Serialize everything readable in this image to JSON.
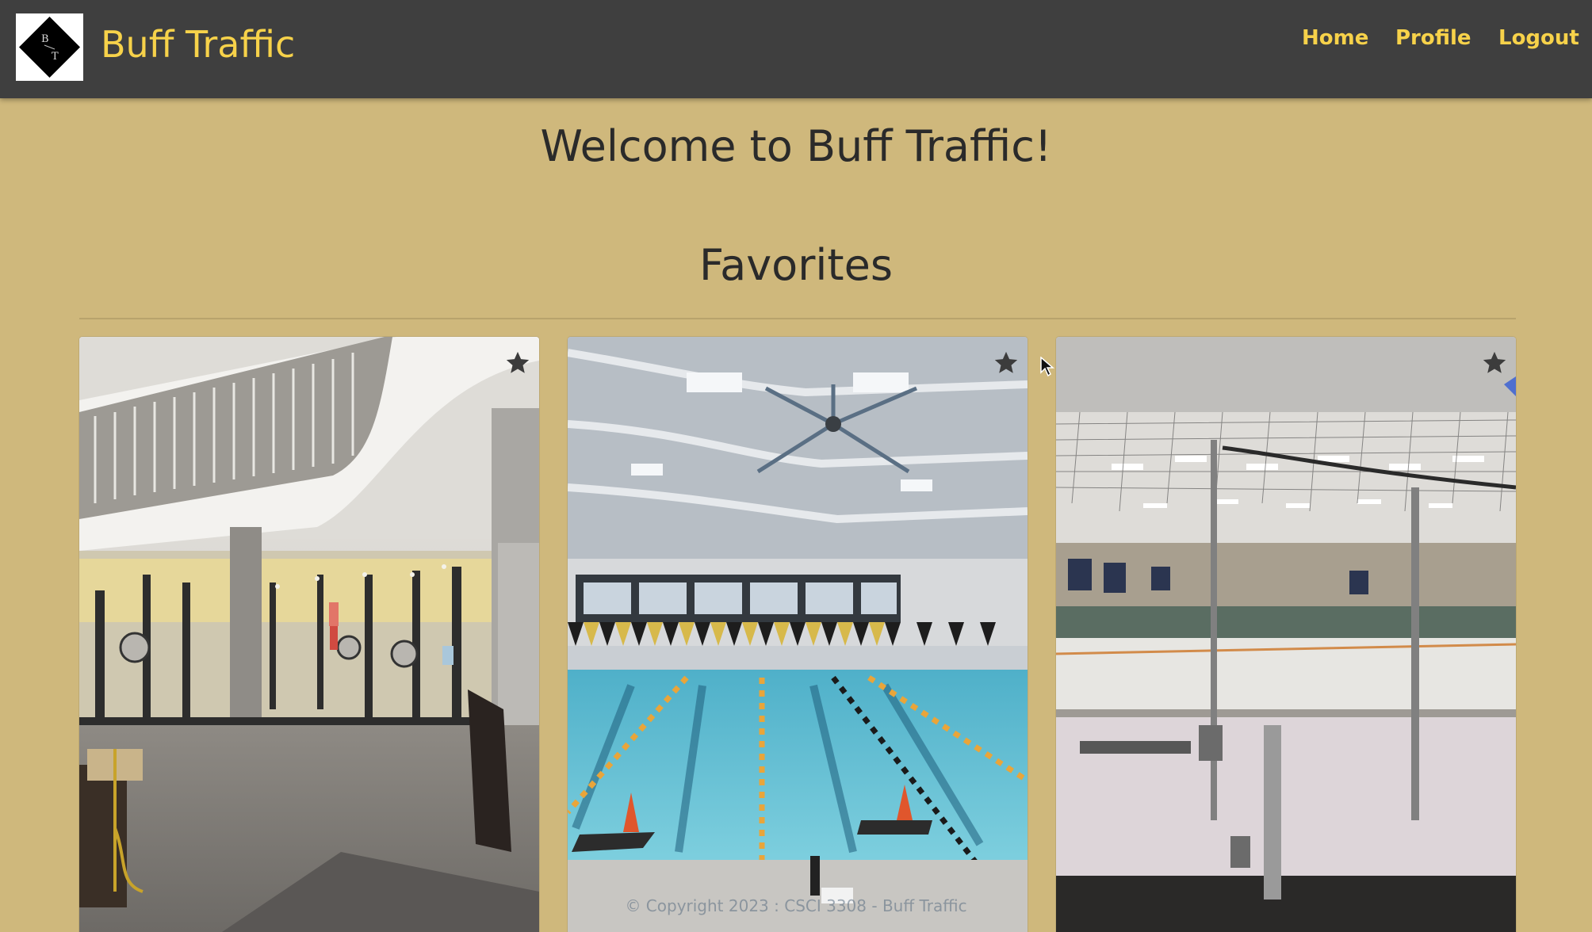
{
  "navbar": {
    "logo_text_top": "B",
    "logo_text_bottom": "T",
    "brand": "Buff Traffic",
    "links": [
      {
        "label": "Home"
      },
      {
        "label": "Profile"
      },
      {
        "label": "Logout"
      }
    ],
    "text_color": "#f7d24a",
    "background": "#3f3f3f"
  },
  "main": {
    "welcome": "Welcome to Buff Traffic!",
    "favorites_heading": "Favorites",
    "background": "#cfb87c",
    "cards": [
      {
        "scene": "weight room",
        "favorite_icon": "star-icon"
      },
      {
        "scene": "swimming pool",
        "favorite_icon": "star-icon"
      },
      {
        "scene": "ice rink",
        "favorite_icon": "star-icon"
      }
    ]
  },
  "footer": {
    "text": "© Copyright 2023 : CSCI 3308 - Buff Traffic"
  }
}
